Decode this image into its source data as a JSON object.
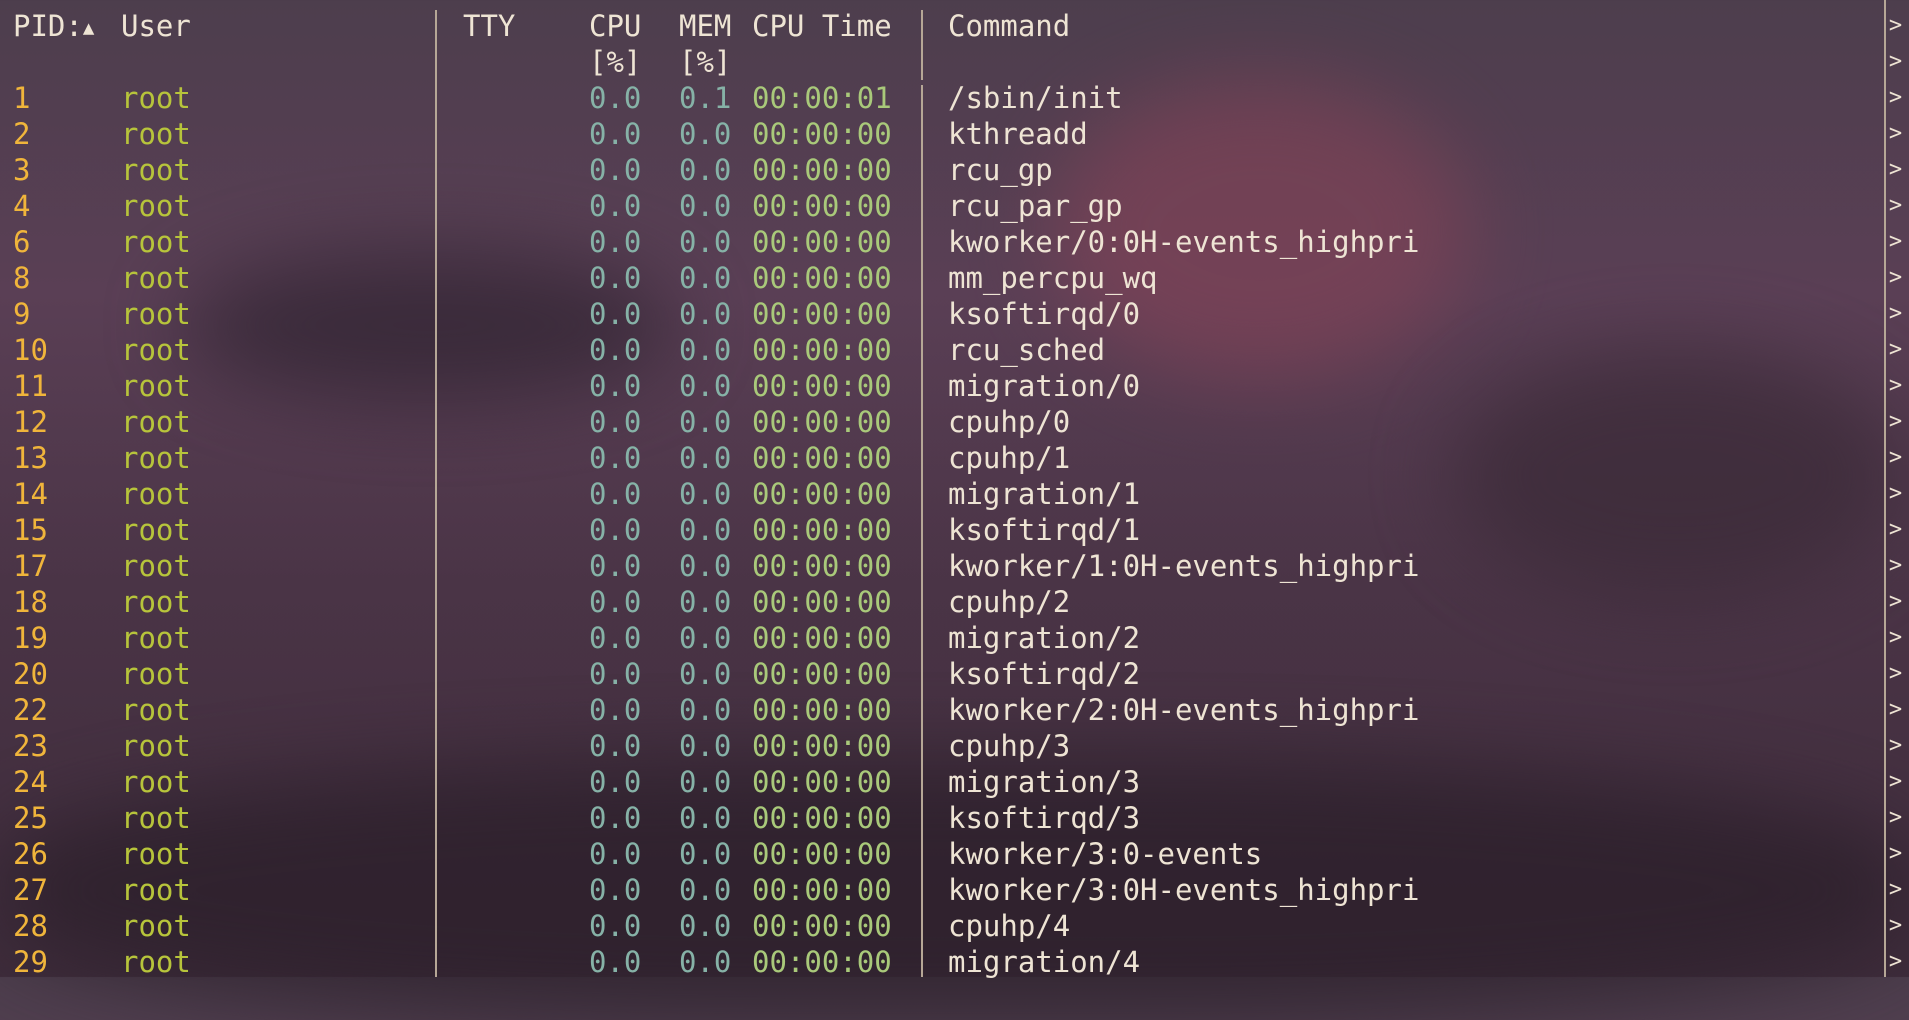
{
  "header": {
    "pid": "PID:",
    "sort_arrow": "▲",
    "user": "User",
    "tty": "TTY",
    "cpu_line1": "CPU",
    "cpu_line2": "[%]",
    "mem_line1": "MEM",
    "mem_line2": "[%]",
    "cpu_time": "CPU Time",
    "command": "Command"
  },
  "overflow_marker": ">",
  "processes": [
    {
      "pid": "1",
      "user": "root",
      "tty": "",
      "cpu": "0.0",
      "mem": "0.1",
      "time": "00:00:01",
      "command": "/sbin/init"
    },
    {
      "pid": "2",
      "user": "root",
      "tty": "",
      "cpu": "0.0",
      "mem": "0.0",
      "time": "00:00:00",
      "command": "kthreadd"
    },
    {
      "pid": "3",
      "user": "root",
      "tty": "",
      "cpu": "0.0",
      "mem": "0.0",
      "time": "00:00:00",
      "command": "rcu_gp"
    },
    {
      "pid": "4",
      "user": "root",
      "tty": "",
      "cpu": "0.0",
      "mem": "0.0",
      "time": "00:00:00",
      "command": "rcu_par_gp"
    },
    {
      "pid": "6",
      "user": "root",
      "tty": "",
      "cpu": "0.0",
      "mem": "0.0",
      "time": "00:00:00",
      "command": "kworker/0:0H-events_highpri"
    },
    {
      "pid": "8",
      "user": "root",
      "tty": "",
      "cpu": "0.0",
      "mem": "0.0",
      "time": "00:00:00",
      "command": "mm_percpu_wq"
    },
    {
      "pid": "9",
      "user": "root",
      "tty": "",
      "cpu": "0.0",
      "mem": "0.0",
      "time": "00:00:00",
      "command": "ksoftirqd/0"
    },
    {
      "pid": "10",
      "user": "root",
      "tty": "",
      "cpu": "0.0",
      "mem": "0.0",
      "time": "00:00:00",
      "command": "rcu_sched"
    },
    {
      "pid": "11",
      "user": "root",
      "tty": "",
      "cpu": "0.0",
      "mem": "0.0",
      "time": "00:00:00",
      "command": "migration/0"
    },
    {
      "pid": "12",
      "user": "root",
      "tty": "",
      "cpu": "0.0",
      "mem": "0.0",
      "time": "00:00:00",
      "command": "cpuhp/0"
    },
    {
      "pid": "13",
      "user": "root",
      "tty": "",
      "cpu": "0.0",
      "mem": "0.0",
      "time": "00:00:00",
      "command": "cpuhp/1"
    },
    {
      "pid": "14",
      "user": "root",
      "tty": "",
      "cpu": "0.0",
      "mem": "0.0",
      "time": "00:00:00",
      "command": "migration/1"
    },
    {
      "pid": "15",
      "user": "root",
      "tty": "",
      "cpu": "0.0",
      "mem": "0.0",
      "time": "00:00:00",
      "command": "ksoftirqd/1"
    },
    {
      "pid": "17",
      "user": "root",
      "tty": "",
      "cpu": "0.0",
      "mem": "0.0",
      "time": "00:00:00",
      "command": "kworker/1:0H-events_highpri"
    },
    {
      "pid": "18",
      "user": "root",
      "tty": "",
      "cpu": "0.0",
      "mem": "0.0",
      "time": "00:00:00",
      "command": "cpuhp/2"
    },
    {
      "pid": "19",
      "user": "root",
      "tty": "",
      "cpu": "0.0",
      "mem": "0.0",
      "time": "00:00:00",
      "command": "migration/2"
    },
    {
      "pid": "20",
      "user": "root",
      "tty": "",
      "cpu": "0.0",
      "mem": "0.0",
      "time": "00:00:00",
      "command": "ksoftirqd/2"
    },
    {
      "pid": "22",
      "user": "root",
      "tty": "",
      "cpu": "0.0",
      "mem": "0.0",
      "time": "00:00:00",
      "command": "kworker/2:0H-events_highpri"
    },
    {
      "pid": "23",
      "user": "root",
      "tty": "",
      "cpu": "0.0",
      "mem": "0.0",
      "time": "00:00:00",
      "command": "cpuhp/3"
    },
    {
      "pid": "24",
      "user": "root",
      "tty": "",
      "cpu": "0.0",
      "mem": "0.0",
      "time": "00:00:00",
      "command": "migration/3"
    },
    {
      "pid": "25",
      "user": "root",
      "tty": "",
      "cpu": "0.0",
      "mem": "0.0",
      "time": "00:00:00",
      "command": "ksoftirqd/3"
    },
    {
      "pid": "26",
      "user": "root",
      "tty": "",
      "cpu": "0.0",
      "mem": "0.0",
      "time": "00:00:00",
      "command": "kworker/3:0-events"
    },
    {
      "pid": "27",
      "user": "root",
      "tty": "",
      "cpu": "0.0",
      "mem": "0.0",
      "time": "00:00:00",
      "command": "kworker/3:0H-events_highpri"
    },
    {
      "pid": "28",
      "user": "root",
      "tty": "",
      "cpu": "0.0",
      "mem": "0.0",
      "time": "00:00:00",
      "command": "cpuhp/4"
    },
    {
      "pid": "29",
      "user": "root",
      "tty": "",
      "cpu": "0.0",
      "mem": "0.0",
      "time": "00:00:00",
      "command": "migration/4"
    }
  ]
}
